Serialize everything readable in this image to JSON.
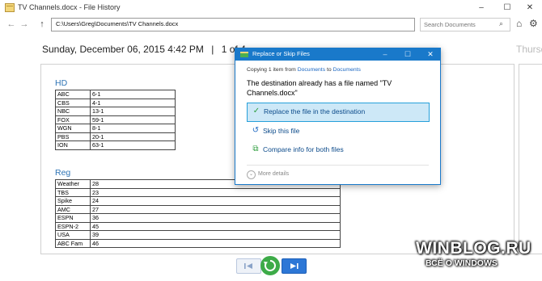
{
  "window": {
    "title": "TV Channels.docx - File History",
    "controls": {
      "minimize": "–",
      "maximize": "☐",
      "close": "✕"
    }
  },
  "nav": {
    "back": "←",
    "forward": "→",
    "up": "↑",
    "address": "C:\\Users\\Greg\\Documents\\TV Channels.docx",
    "refresh": "↻",
    "search_placeholder": "Search Documents",
    "search_icon": "⌕",
    "home_icon": "⌂",
    "settings_icon": "⚙"
  },
  "version": {
    "date": "Sunday, December 06, 2015 4:42 PM",
    "separator": "|",
    "position": "1 of 4",
    "next_date": "Thursd"
  },
  "document": {
    "hd_heading": "HD",
    "hd_rows": [
      [
        "ABC",
        "6-1"
      ],
      [
        "CBS",
        "4-1"
      ],
      [
        "NBC",
        "13-1"
      ],
      [
        "FOX",
        "59-1"
      ],
      [
        "WGN",
        "8-1"
      ],
      [
        "PBS",
        "20-1"
      ],
      [
        "ION",
        "63-1"
      ]
    ],
    "reg_heading": "Reg",
    "reg_rows": [
      [
        "Weather",
        "28"
      ],
      [
        "TBS",
        "23"
      ],
      [
        "Spike",
        "24"
      ],
      [
        "AMC",
        "27"
      ],
      [
        "ESPN",
        "36"
      ],
      [
        "ESPN-2",
        "45"
      ],
      [
        "USA",
        "39"
      ],
      [
        "ABC Fam",
        "46"
      ]
    ]
  },
  "dialog": {
    "title": "Replace or Skip Files",
    "controls": {
      "minimize": "–",
      "maximize": "☐",
      "close": "✕"
    },
    "copy_prefix": "Copying 1 item from ",
    "copy_from": "Documents",
    "copy_mid": " to ",
    "copy_to": "Documents",
    "message": "The destination already has a file named \"TV Channels.docx\"",
    "options": {
      "replace": {
        "icon": "✓",
        "label": "Replace the file in the destination"
      },
      "skip": {
        "icon": "↺",
        "label": "Skip this file"
      },
      "compare": {
        "icon": "⧉",
        "label": "Compare info for both files"
      }
    },
    "more_icon": "⌄",
    "more_details": "More details"
  },
  "watermark": {
    "title": "WINBLOG.RU",
    "subtitle": "ВСЁ О WINDOWS"
  },
  "colors": {
    "accent": "#1979ca",
    "heading": "#2e74b5",
    "restore_green": "#3dab48",
    "selected_bg": "#cde8f7"
  }
}
